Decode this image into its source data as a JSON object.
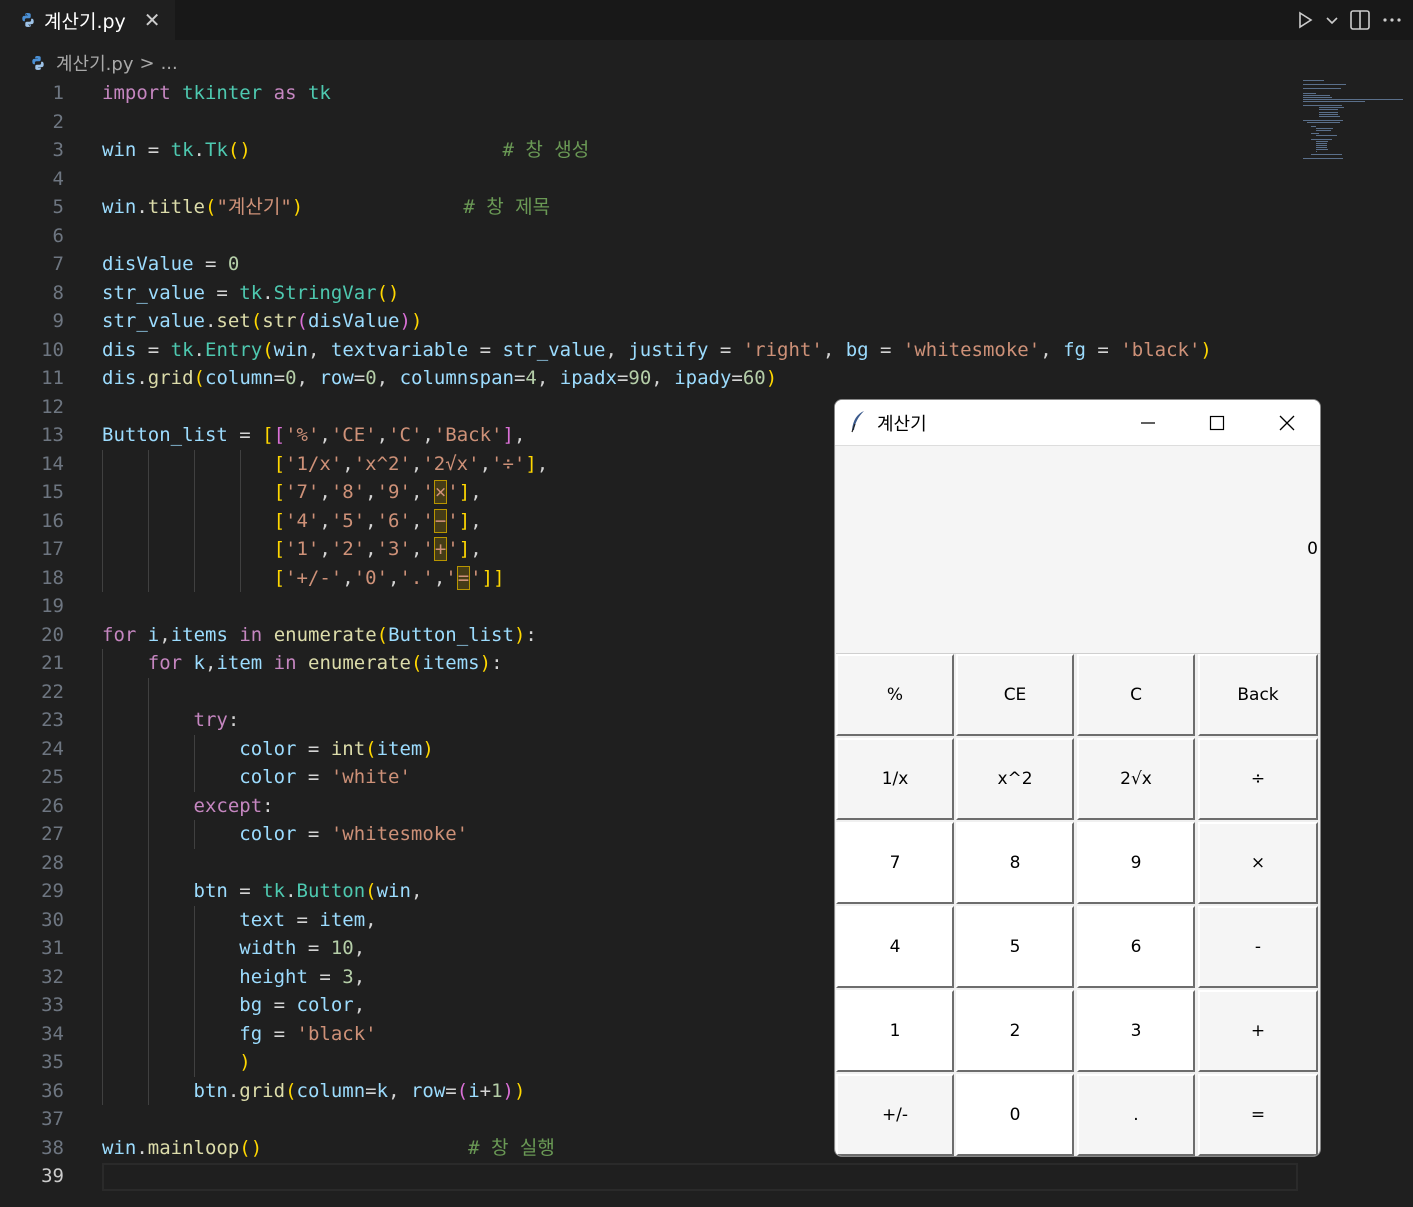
{
  "tab": {
    "filename": "계산기.py",
    "close": "✕"
  },
  "breadcrumb": {
    "file": "계산기.py",
    "sep": ">",
    "more": "..."
  },
  "editor": {
    "current_line": 39,
    "line_numbers": [
      "1",
      "2",
      "3",
      "4",
      "5",
      "6",
      "7",
      "8",
      "9",
      "10",
      "11",
      "12",
      "13",
      "14",
      "15",
      "16",
      "17",
      "18",
      "19",
      "20",
      "21",
      "22",
      "23",
      "24",
      "25",
      "26",
      "27",
      "28",
      "29",
      "30",
      "31",
      "32",
      "33",
      "34",
      "35",
      "36",
      "37",
      "38",
      "39"
    ],
    "lines": [
      "import tkinter as tk",
      "",
      "win = tk.Tk()                      # 창 생성",
      "",
      "win.title(\"계산기\")              # 창 제목",
      "",
      "disValue = 0",
      "str_value = tk.StringVar()",
      "str_value.set(str(disValue))",
      "dis = tk.Entry(win, textvariable = str_value, justify = 'right', bg = 'whitesmoke', fg = 'black')",
      "dis.grid(column=0, row=0, columnspan=4, ipadx=90, ipady=60)",
      "",
      "Button_list = [['%','CE','C','Back'],",
      "               ['1/x','x^2','2√x','÷'],",
      "               ['7','8','9','×'],",
      "               ['4','5','6','−'],",
      "               ['1','2','3','+'],",
      "               ['+/-','0','.','=']]",
      "",
      "for i,items in enumerate(Button_list):",
      "    for k,item in enumerate(items):",
      "",
      "        try:",
      "            color = int(item)",
      "            color = 'white'",
      "        except:",
      "            color = 'whitesmoke'",
      "",
      "        btn = tk.Button(win,",
      "            text = item,",
      "            width = 10,",
      "            height = 3,",
      "            bg = color,",
      "            fg = 'black'",
      "            )",
      "        btn.grid(column=k, row=(i+1))",
      "",
      "win.mainloop()                  # 창 실행",
      ""
    ]
  },
  "tk_window": {
    "title": "계산기",
    "display_value": "0",
    "controls": {
      "minimize": "—",
      "maximize": "☐",
      "close": "✕"
    },
    "buttons": [
      [
        "%",
        "CE",
        "C",
        "Back"
      ],
      [
        "1/x",
        "x^2",
        "2√x",
        "÷"
      ],
      [
        "7",
        "8",
        "9",
        "×"
      ],
      [
        "4",
        "5",
        "6",
        "-"
      ],
      [
        "1",
        "2",
        "3",
        "+"
      ],
      [
        "+/-",
        "0",
        ".",
        "="
      ]
    ]
  },
  "colors": {
    "editor_bg": "#1f1f1f",
    "tab_bg": "#181818",
    "keyword": "#c586c0",
    "string": "#ce9178",
    "comment": "#6a9955",
    "entry_bg": "#f5f5f5"
  }
}
